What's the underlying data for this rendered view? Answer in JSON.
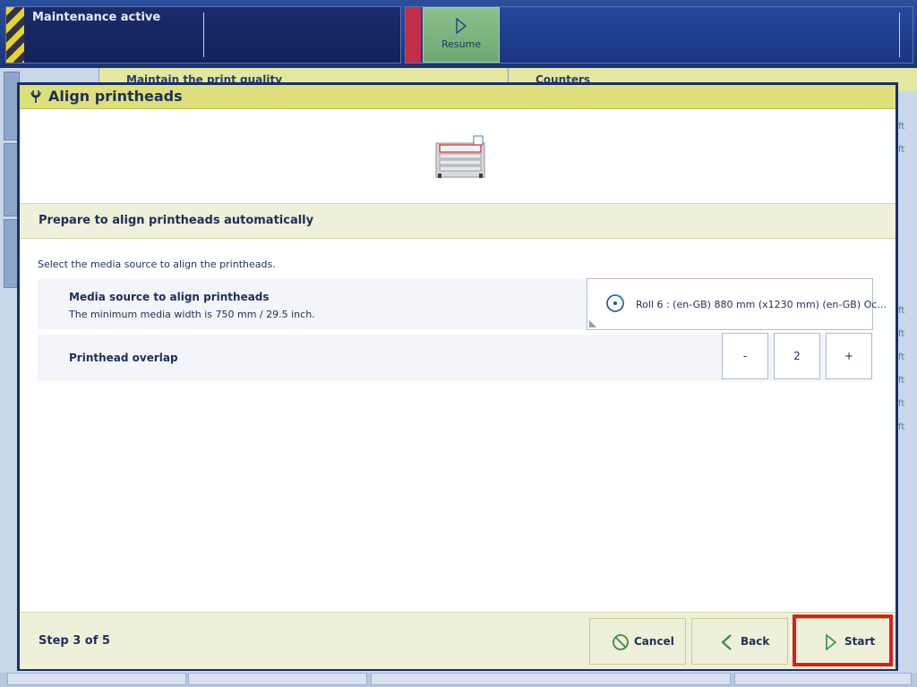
{
  "status_bar": {
    "maintenance_label": "Maintenance active",
    "resume_label": "Resume"
  },
  "background": {
    "tab_left": "Maintain the print quality",
    "tab_right": "Counters",
    "edge_fragment": "ft"
  },
  "dialog": {
    "title": "Align printheads",
    "section_title": "Prepare to align printheads automatically",
    "instruction": "Select the media source to align the printheads.",
    "media_source": {
      "label": "Media source to align printheads",
      "sublabel": "The minimum media width is 750 mm / 29.5 inch.",
      "value": "Roll 6 : (en-GB) 880 mm (x1230 mm) (en-GB) Oc..."
    },
    "overlap": {
      "label": "Printhead overlap",
      "decrement": "-",
      "value": "2",
      "increment": "+"
    },
    "footer": {
      "step": "Step 3 of 5",
      "cancel": "Cancel",
      "back": "Back",
      "start": "Start"
    }
  },
  "colors": {
    "header": "#dde07a",
    "section": "#eef0d9",
    "highlight": "#e21c1c",
    "resume": "#7db47f"
  }
}
